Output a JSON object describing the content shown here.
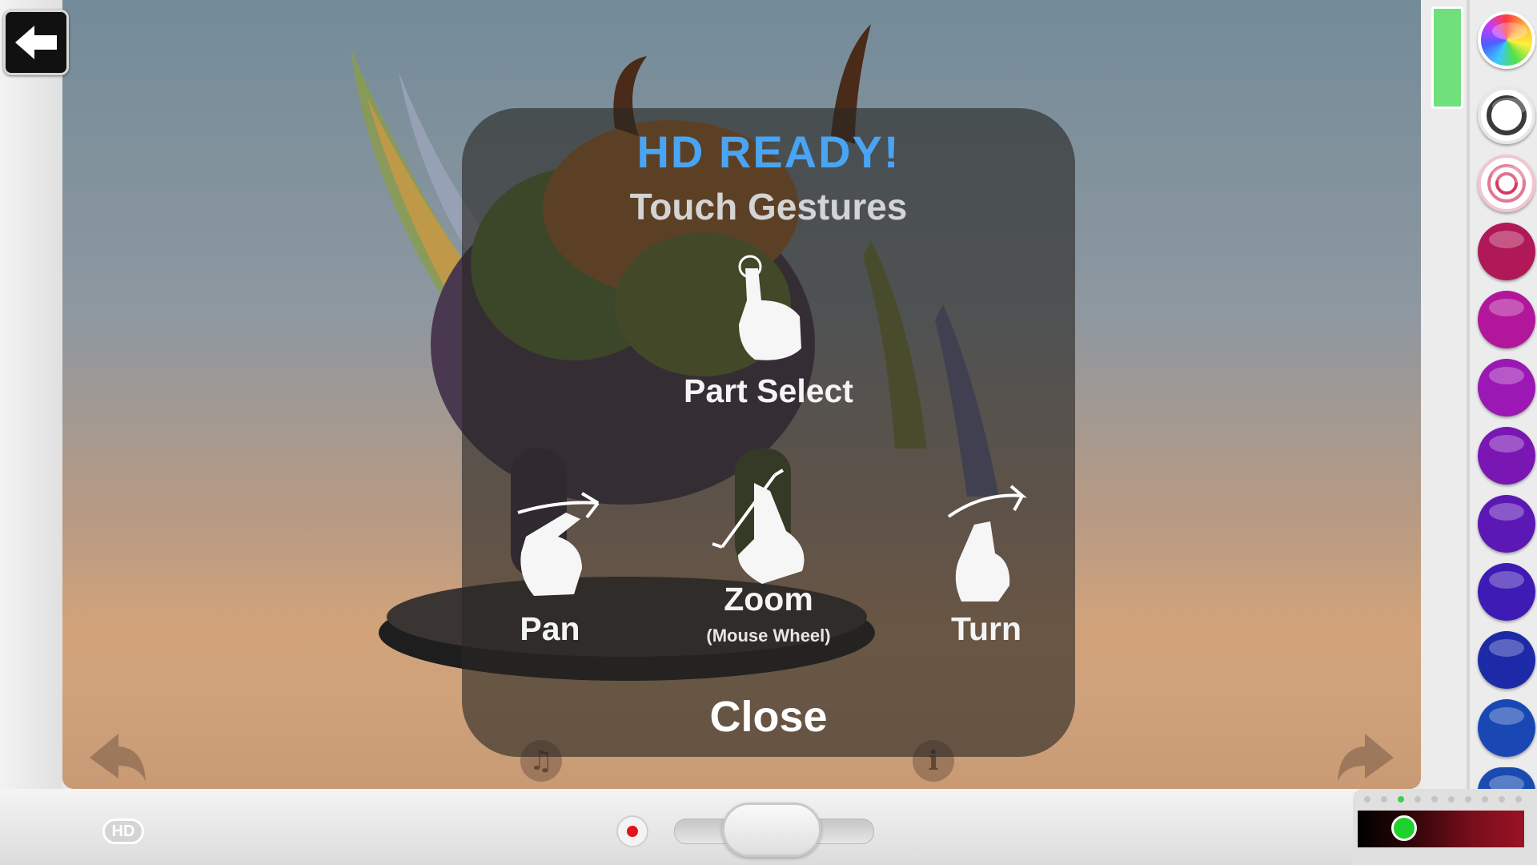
{
  "overlay": {
    "title": "HD READY!",
    "subtitle": "Touch Gestures",
    "gestures": {
      "part_select": "Part Select",
      "pan": "Pan",
      "zoom": "Zoom",
      "zoom_sub": "(Mouse Wheel)",
      "turn": "Turn"
    },
    "close_label": "Close"
  },
  "bottom_bar": {
    "hd_badge": "HD"
  },
  "icons": {
    "back": "back-arrow-icon",
    "undo": "undo-arrow-icon",
    "redo": "redo-arrow-icon",
    "music": "music-note-icon",
    "info": "info-icon",
    "record": "record-icon"
  },
  "palette": {
    "swatches": [
      "rainbow",
      "#5a5a5a",
      "#d63a5f",
      "#b01858",
      "#b2179b",
      "#9c18b4",
      "#7a16b3",
      "#5c18b4",
      "#3e1bb4",
      "#1d2aa8",
      "#1948b5",
      "#1a4cb0"
    ],
    "selected_color": "#1ed12d",
    "page_dots_active": 2
  },
  "colors": {
    "title_blue": "#49a4f4",
    "overlay_bg": "rgba(40,38,36,0.62)",
    "accent_green": "#6fe07c"
  }
}
